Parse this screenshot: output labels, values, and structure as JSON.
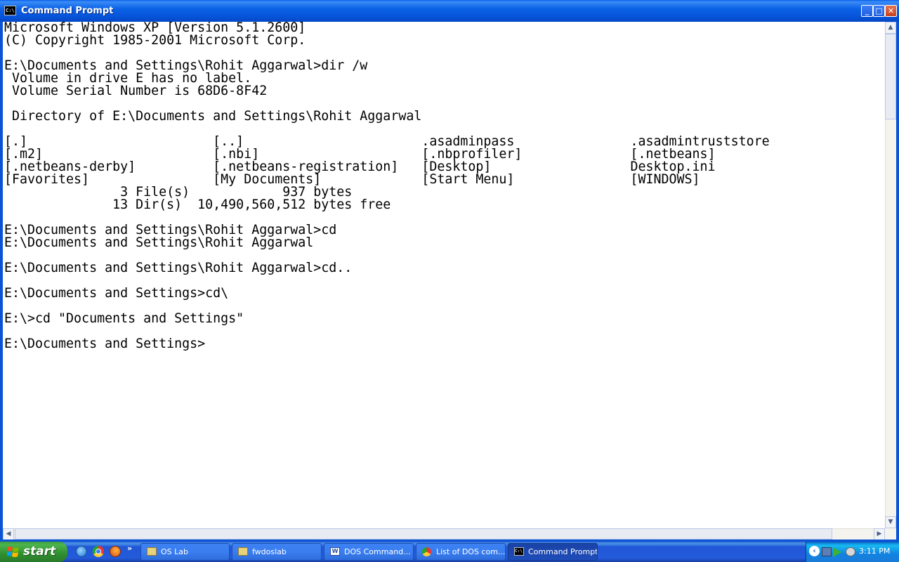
{
  "window": {
    "title": "Command Prompt",
    "icon_text": "C:\\",
    "minimize_glyph": "_",
    "maximize_glyph": "□",
    "close_glyph": "✕"
  },
  "console": {
    "lines": [
      "Microsoft Windows XP [Version 5.1.2600]",
      "(C) Copyright 1985-2001 Microsoft Corp.",
      "",
      "E:\\Documents and Settings\\Rohit Aggarwal>dir /w",
      " Volume in drive E has no label.",
      " Volume Serial Number is 68D6-8F42",
      "",
      " Directory of E:\\Documents and Settings\\Rohit Aggarwal",
      "",
      "[.]                        [..]                       .asadminpass               .asadmintruststore",
      "[.m2]                      [.nbi]                     [.nbprofiler]              [.netbeans]",
      "[.netbeans-derby]          [.netbeans-registration]   [Desktop]                  Desktop.ini",
      "[Favorites]                [My Documents]             [Start Menu]               [WINDOWS]",
      "               3 File(s)            937 bytes",
      "              13 Dir(s)  10,490,560,512 bytes free",
      "",
      "E:\\Documents and Settings\\Rohit Aggarwal>cd",
      "E:\\Documents and Settings\\Rohit Aggarwal",
      "",
      "E:\\Documents and Settings\\Rohit Aggarwal>cd..",
      "",
      "E:\\Documents and Settings>cd\\",
      "",
      "E:\\>cd \"Documents and Settings\"",
      "",
      "E:\\Documents and Settings>"
    ]
  },
  "scrollbars": {
    "up_glyph": "▲",
    "down_glyph": "▼",
    "left_glyph": "◀",
    "right_glyph": "▶"
  },
  "taskbar": {
    "start_label": "start",
    "quicklaunch_more": "»",
    "tasks": [
      {
        "label": "OS Lab",
        "icon": "folder-icon",
        "active": false
      },
      {
        "label": "fwdoslab",
        "icon": "folder-icon",
        "active": false
      },
      {
        "label": "DOS Command...",
        "icon": "word-document-icon",
        "active": false
      },
      {
        "label": "List of DOS com...",
        "icon": "chrome-icon",
        "active": false
      },
      {
        "label": "Command Prompt",
        "icon": "command-prompt-icon",
        "active": true
      }
    ],
    "tray_arrow": "‹",
    "clock": "3:11 PM"
  },
  "colors": {
    "titlebar": "#0b62e6",
    "taskbar": "#235bdb",
    "start_button": "#3c9d3c",
    "console_bg": "#ffffff",
    "console_text": "#000000"
  }
}
